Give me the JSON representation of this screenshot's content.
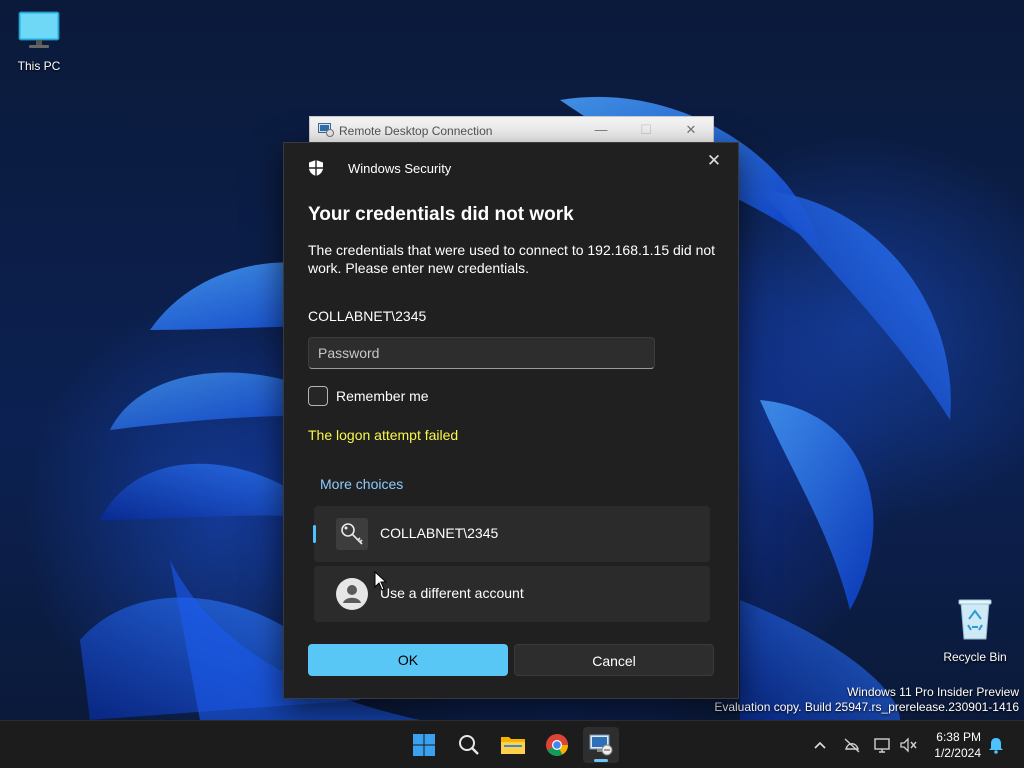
{
  "desktop": {
    "this_pc_label": "This PC",
    "recycle_bin_label": "Recycle Bin",
    "watermark_line1": "Windows 11 Pro Insider Preview",
    "watermark_line2": "Evaluation copy. Build 25947.rs_prerelease.230901-1416"
  },
  "rdc_window": {
    "title": "Remote Desktop Connection",
    "minimize_glyph": "—",
    "maximize_glyph": "☐",
    "close_glyph": "✕"
  },
  "dialog": {
    "app_name": "Windows Security",
    "close_glyph": "✕",
    "heading": "Your credentials did not work",
    "description": "The credentials that were used to connect to 192.168.1.15 did not work. Please enter new credentials.",
    "username": "COLLABNET\\2345",
    "password_placeholder": "Password",
    "password_value": "",
    "remember_label": "Remember me",
    "remember_checked": false,
    "error_text": "The logon attempt failed",
    "more_choices_label": "More choices",
    "choices": [
      {
        "label": "COLLABNET\\2345",
        "icon": "key-icon",
        "selected": true
      },
      {
        "label": "Use a different account",
        "icon": "user-avatar-icon",
        "selected": false
      }
    ],
    "ok_label": "OK",
    "cancel_label": "Cancel",
    "accent_color": "#58c7f5",
    "error_color": "#f8f84a"
  },
  "taskbar": {
    "apps": [
      "start-icon",
      "search-icon",
      "file-explorer-icon",
      "chrome-icon",
      "remote-desktop-icon"
    ],
    "active_app": "remote-desktop-icon",
    "tray_icons": [
      "chevron-up-icon",
      "network-off-icon",
      "display-icon",
      "volume-muted-icon",
      "notification-bell-icon"
    ],
    "time": "6:38 PM",
    "date": "1/2/2024"
  }
}
